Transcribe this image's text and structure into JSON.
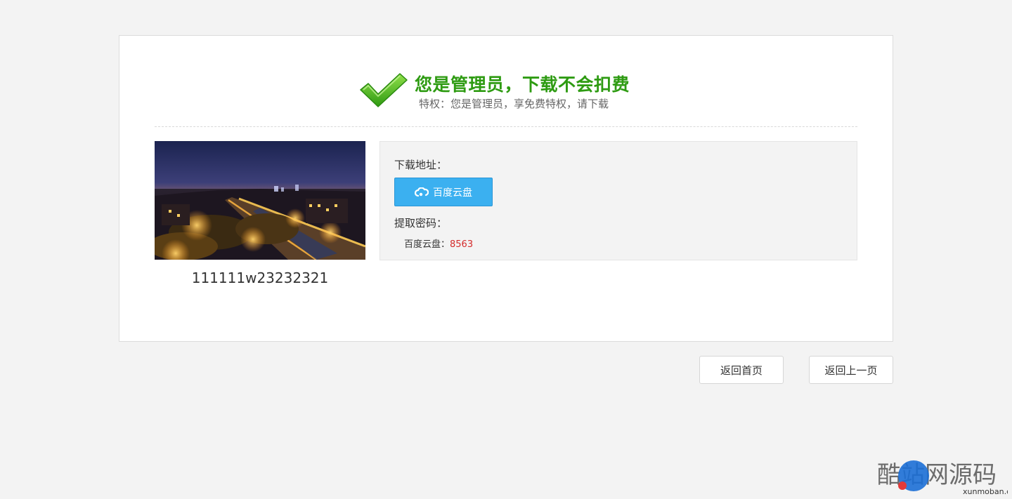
{
  "header": {
    "title": "您是管理员，下载不会扣费",
    "subtitle": "特权：您是管理员，享免费特权，请下载"
  },
  "item": {
    "title": "111111w23232321"
  },
  "download": {
    "address_label": "下载地址：",
    "button_label": "百度云盘",
    "password_label": "提取密码：",
    "password_prefix": "百度云盘：",
    "password_code": "8563"
  },
  "nav": {
    "home_label": "返回首页",
    "back_label": "返回上一页"
  },
  "watermark": {
    "text": "酷站网源码",
    "sub_text": "xunmoban.com"
  },
  "colors": {
    "accent_green": "#2e9b12",
    "button_blue": "#3bb0f0",
    "code_red": "#d42b2b"
  },
  "icons": [
    "checkmark-icon",
    "cloud-icon"
  ]
}
